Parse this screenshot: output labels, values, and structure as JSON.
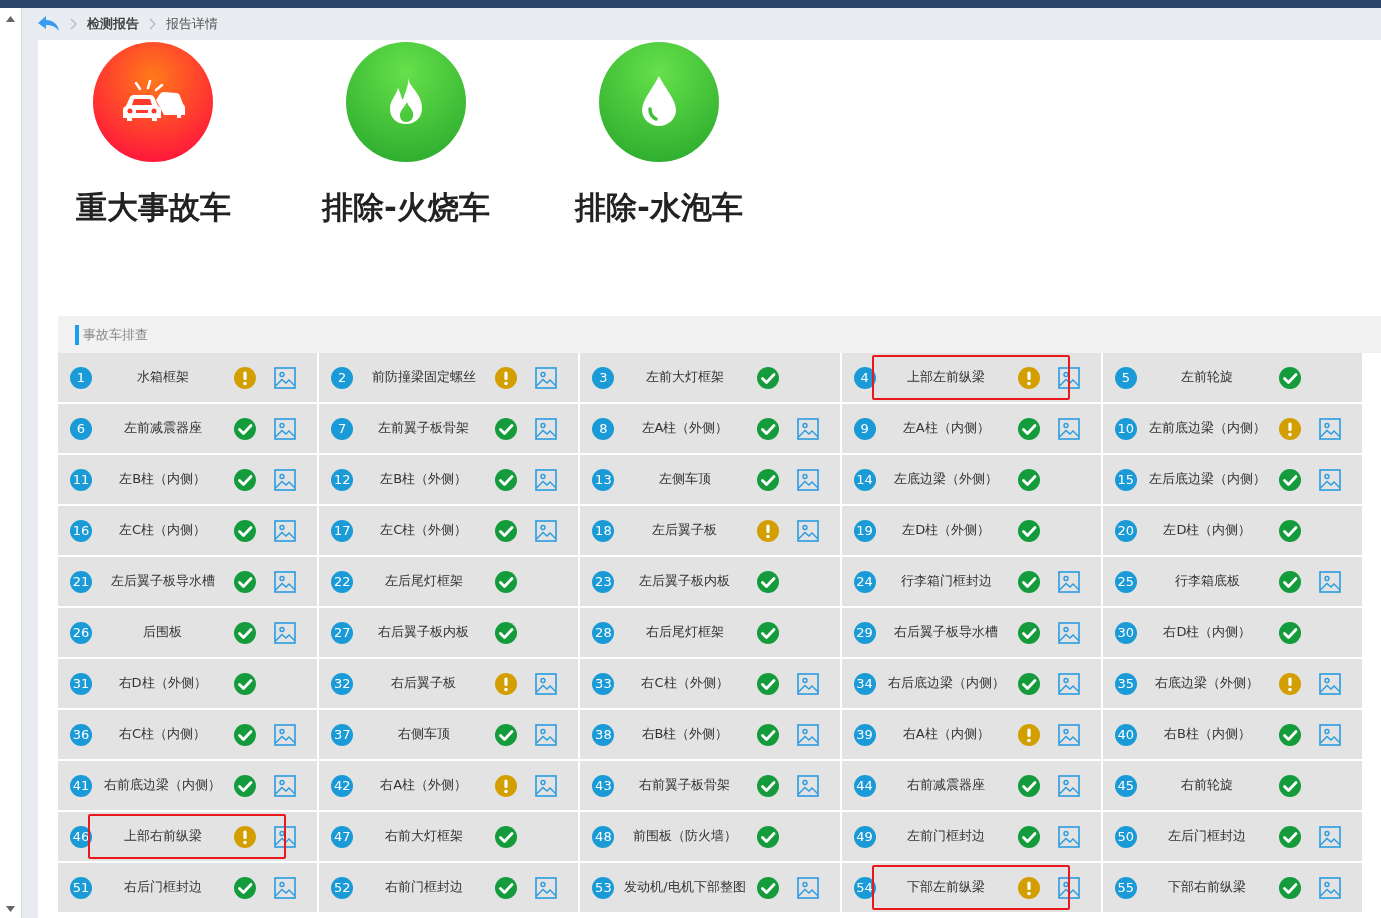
{
  "breadcrumb": [
    {
      "label": "检测报告",
      "current": false
    },
    {
      "label": "报告详情",
      "current": true
    }
  ],
  "verdicts": [
    {
      "label": "重大事故车",
      "kind": "accident"
    },
    {
      "label": "排除-火烧车",
      "kind": "fire"
    },
    {
      "label": "排除-水泡车",
      "kind": "water"
    }
  ],
  "section": {
    "title": "事故车排查"
  },
  "checks": [
    {
      "number": "1",
      "label": "水箱框架",
      "passed": false,
      "has_photo": true,
      "highlighted": false
    },
    {
      "number": "2",
      "label": "前防撞梁固定螺丝",
      "passed": false,
      "has_photo": true,
      "highlighted": false
    },
    {
      "number": "3",
      "label": "左前大灯框架",
      "passed": true,
      "has_photo": false,
      "highlighted": false
    },
    {
      "number": "4",
      "label": "上部左前纵梁",
      "passed": false,
      "has_photo": true,
      "highlighted": true
    },
    {
      "number": "5",
      "label": "左前轮旋",
      "passed": true,
      "has_photo": false,
      "highlighted": false
    },
    {
      "number": "6",
      "label": "左前减震器座",
      "passed": true,
      "has_photo": true,
      "highlighted": false
    },
    {
      "number": "7",
      "label": "左前翼子板骨架",
      "passed": true,
      "has_photo": true,
      "highlighted": false
    },
    {
      "number": "8",
      "label": "左A柱（外侧）",
      "passed": true,
      "has_photo": true,
      "highlighted": false
    },
    {
      "number": "9",
      "label": "左A柱（内侧）",
      "passed": true,
      "has_photo": true,
      "highlighted": false
    },
    {
      "number": "10",
      "label": "左前底边梁（内侧）",
      "passed": false,
      "has_photo": true,
      "highlighted": false
    },
    {
      "number": "11",
      "label": "左B柱（内侧）",
      "passed": true,
      "has_photo": true,
      "highlighted": false
    },
    {
      "number": "12",
      "label": "左B柱（外侧）",
      "passed": true,
      "has_photo": true,
      "highlighted": false
    },
    {
      "number": "13",
      "label": "左侧车顶",
      "passed": true,
      "has_photo": true,
      "highlighted": false
    },
    {
      "number": "14",
      "label": "左底边梁（外侧）",
      "passed": true,
      "has_photo": false,
      "highlighted": false
    },
    {
      "number": "15",
      "label": "左后底边梁（内侧）",
      "passed": true,
      "has_photo": true,
      "highlighted": false
    },
    {
      "number": "16",
      "label": "左C柱（内侧）",
      "passed": true,
      "has_photo": true,
      "highlighted": false
    },
    {
      "number": "17",
      "label": "左C柱（外侧）",
      "passed": true,
      "has_photo": true,
      "highlighted": false
    },
    {
      "number": "18",
      "label": "左后翼子板",
      "passed": false,
      "has_photo": true,
      "highlighted": false
    },
    {
      "number": "19",
      "label": "左D柱（外侧）",
      "passed": true,
      "has_photo": false,
      "highlighted": false
    },
    {
      "number": "20",
      "label": "左D柱（内侧）",
      "passed": true,
      "has_photo": false,
      "highlighted": false
    },
    {
      "number": "21",
      "label": "左后翼子板导水槽",
      "passed": true,
      "has_photo": true,
      "highlighted": false
    },
    {
      "number": "22",
      "label": "左后尾灯框架",
      "passed": true,
      "has_photo": false,
      "highlighted": false
    },
    {
      "number": "23",
      "label": "左后翼子板内板",
      "passed": true,
      "has_photo": false,
      "highlighted": false
    },
    {
      "number": "24",
      "label": "行李箱门框封边",
      "passed": true,
      "has_photo": true,
      "highlighted": false
    },
    {
      "number": "25",
      "label": "行李箱底板",
      "passed": true,
      "has_photo": true,
      "highlighted": false
    },
    {
      "number": "26",
      "label": "后围板",
      "passed": true,
      "has_photo": true,
      "highlighted": false
    },
    {
      "number": "27",
      "label": "右后翼子板内板",
      "passed": true,
      "has_photo": false,
      "highlighted": false
    },
    {
      "number": "28",
      "label": "右后尾灯框架",
      "passed": true,
      "has_photo": false,
      "highlighted": false
    },
    {
      "number": "29",
      "label": "右后翼子板导水槽",
      "passed": true,
      "has_photo": true,
      "highlighted": false
    },
    {
      "number": "30",
      "label": "右D柱（内侧）",
      "passed": true,
      "has_photo": false,
      "highlighted": false
    },
    {
      "number": "31",
      "label": "右D柱（外侧）",
      "passed": true,
      "has_photo": false,
      "highlighted": false
    },
    {
      "number": "32",
      "label": "右后翼子板",
      "passed": false,
      "has_photo": true,
      "highlighted": false
    },
    {
      "number": "33",
      "label": "右C柱（外侧）",
      "passed": true,
      "has_photo": true,
      "highlighted": false
    },
    {
      "number": "34",
      "label": "右后底边梁（内侧）",
      "passed": true,
      "has_photo": true,
      "highlighted": false
    },
    {
      "number": "35",
      "label": "右底边梁（外侧）",
      "passed": false,
      "has_photo": true,
      "highlighted": false
    },
    {
      "number": "36",
      "label": "右C柱（内侧）",
      "passed": true,
      "has_photo": true,
      "highlighted": false
    },
    {
      "number": "37",
      "label": "右侧车顶",
      "passed": true,
      "has_photo": true,
      "highlighted": false
    },
    {
      "number": "38",
      "label": "右B柱（外侧）",
      "passed": true,
      "has_photo": true,
      "highlighted": false
    },
    {
      "number": "39",
      "label": "右A柱（内侧）",
      "passed": false,
      "has_photo": true,
      "highlighted": false
    },
    {
      "number": "40",
      "label": "右B柱（内侧）",
      "passed": true,
      "has_photo": true,
      "highlighted": false
    },
    {
      "number": "41",
      "label": "右前底边梁（内侧）",
      "passed": true,
      "has_photo": true,
      "highlighted": false
    },
    {
      "number": "42",
      "label": "右A柱（外侧）",
      "passed": false,
      "has_photo": true,
      "highlighted": false
    },
    {
      "number": "43",
      "label": "右前翼子板骨架",
      "passed": true,
      "has_photo": true,
      "highlighted": false
    },
    {
      "number": "44",
      "label": "右前减震器座",
      "passed": true,
      "has_photo": true,
      "highlighted": false
    },
    {
      "number": "45",
      "label": "右前轮旋",
      "passed": true,
      "has_photo": false,
      "highlighted": false
    },
    {
      "number": "46",
      "label": "上部右前纵梁",
      "passed": false,
      "has_photo": true,
      "highlighted": true
    },
    {
      "number": "47",
      "label": "右前大灯框架",
      "passed": true,
      "has_photo": false,
      "highlighted": false
    },
    {
      "number": "48",
      "label": "前围板（防火墙）",
      "passed": true,
      "has_photo": false,
      "highlighted": false
    },
    {
      "number": "49",
      "label": "左前门框封边",
      "passed": true,
      "has_photo": true,
      "highlighted": false
    },
    {
      "number": "50",
      "label": "左后门框封边",
      "passed": true,
      "has_photo": true,
      "highlighted": false
    },
    {
      "number": "51",
      "label": "右后门框封边",
      "passed": true,
      "has_photo": true,
      "highlighted": false
    },
    {
      "number": "52",
      "label": "右前门框封边",
      "passed": true,
      "has_photo": true,
      "highlighted": false
    },
    {
      "number": "53",
      "label": "发动机/电机下部整图",
      "passed": true,
      "has_photo": true,
      "highlighted": false
    },
    {
      "number": "54",
      "label": "下部左前纵梁",
      "passed": false,
      "has_photo": true,
      "highlighted": true
    },
    {
      "number": "55",
      "label": "下部右前纵梁",
      "passed": true,
      "has_photo": true,
      "highlighted": false
    }
  ]
}
